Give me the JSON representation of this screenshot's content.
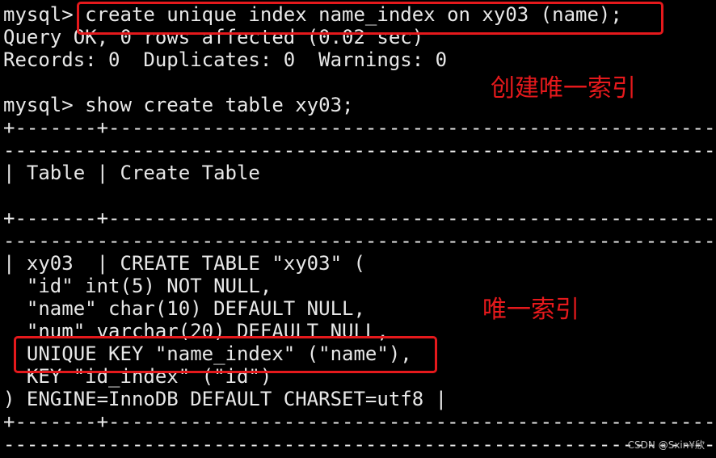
{
  "terminal": {
    "lines": [
      "mysql> create unique index name_index on xy03 (name);",
      "Query OK, 0 rows affected (0.02 sec)",
      "Records: 0  Duplicates: 0  Warnings: 0",
      "",
      "mysql> show create table xy03;",
      "+-------+------------------------------------------------------",
      "--------------------------------------------------------------",
      "| Table | Create Table",
      "",
      "+-------+------------------------------------------------------",
      "--------------------------------------------------------------",
      "| xy03  | CREATE TABLE \"xy03\" (",
      "  \"id\" int(5) NOT NULL,",
      "  \"name\" char(10) DEFAULT NULL,",
      "  \"num\" varchar(20) DEFAULT NULL,",
      "  UNIQUE KEY \"name_index\" (\"name\"),",
      "  KEY \"id_index\" (\"id\")",
      ") ENGINE=InnoDB DEFAULT CHARSET=utf8 |",
      "+-------+------------------------------------------------------",
      "--------------------------------------------------------------"
    ]
  },
  "annotations": {
    "create_unique_index": "创建唯一索引",
    "unique_index": "唯一索引",
    "color": "#e5191c"
  },
  "watermark": "CSDN @Sxin¥欣"
}
